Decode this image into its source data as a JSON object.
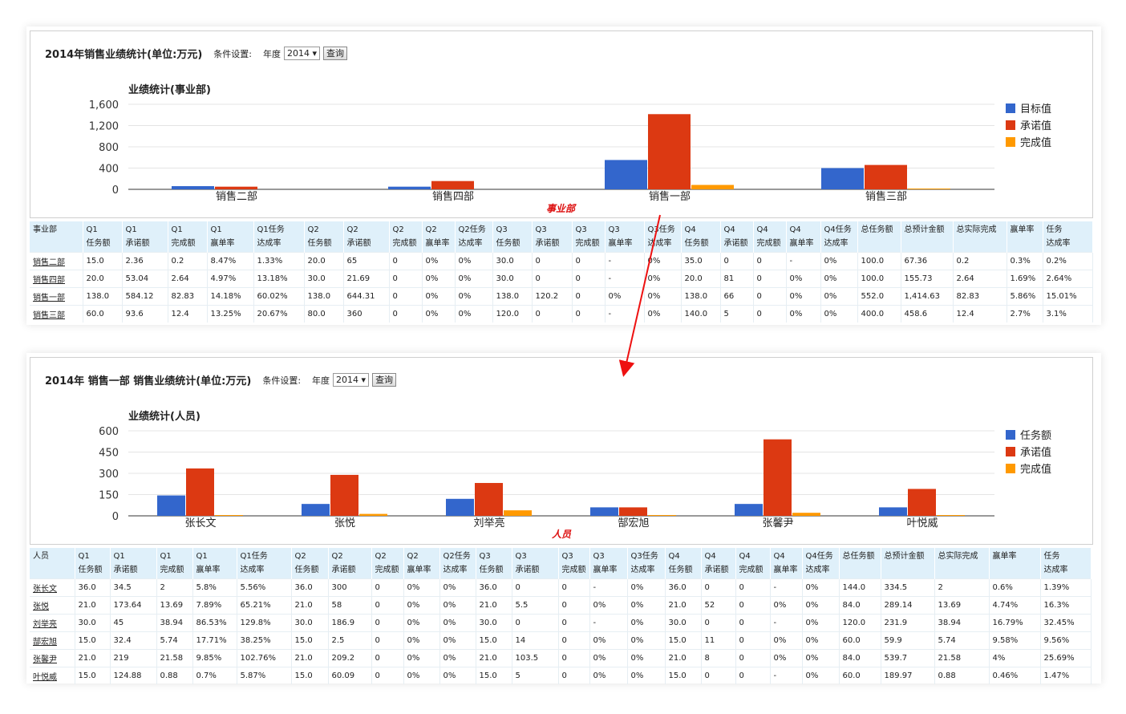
{
  "panel1": {
    "title": "2014年销售业绩统计(单位:万元)",
    "filter_label": "条件设置:",
    "year_label": "年度",
    "year_value": "2014 ▾",
    "query_label": "查询",
    "annotation": "事业部"
  },
  "panel2": {
    "title": "2014年 销售一部 销售业绩统计(单位:万元)",
    "filter_label": "条件设置:",
    "year_label": "年度",
    "year_value": "2014 ▾",
    "query_label": "查询",
    "annotation": "人员"
  },
  "colors": {
    "blue": "#3366cc",
    "red": "#dc3912",
    "orange": "#ff9900"
  },
  "chart_data": [
    {
      "type": "bar",
      "title": "业绩统计(事业部)",
      "categories": [
        "销售二部",
        "销售四部",
        "销售一部",
        "销售三部"
      ],
      "series": [
        {
          "name": "目标值",
          "values": [
            60,
            50,
            552,
            400
          ]
        },
        {
          "name": "承诺值",
          "values": [
            50,
            155.73,
            1414.63,
            458.6
          ]
        },
        {
          "name": "完成值",
          "values": [
            0,
            0,
            82.83,
            12.4
          ]
        }
      ],
      "yticks": [
        "0",
        "400",
        "800",
        "1,200",
        "1,600"
      ],
      "ylim": [
        0,
        1600
      ],
      "grid": true,
      "legend": "right"
    },
    {
      "type": "bar",
      "title": "业绩统计(人员)",
      "categories": [
        "张长文",
        "张悦",
        "刘举亮",
        "郜宏旭",
        "张馨尹",
        "叶悦威"
      ],
      "series": [
        {
          "name": "任务额",
          "values": [
            144,
            84,
            120,
            60,
            84,
            60
          ]
        },
        {
          "name": "承诺值",
          "values": [
            334.5,
            289.14,
            231.9,
            59.9,
            539.7,
            189.97
          ]
        },
        {
          "name": "完成值",
          "values": [
            2,
            13.69,
            38.94,
            5.74,
            21.58,
            0.88
          ]
        }
      ],
      "yticks": [
        "0",
        "150",
        "300",
        "450",
        "600"
      ],
      "ylim": [
        0,
        600
      ],
      "grid": true,
      "legend": "right"
    }
  ],
  "table1": {
    "headers": [
      [
        "事业部",
        ""
      ],
      [
        "Q1",
        "任务额"
      ],
      [
        "Q1",
        "承诺额"
      ],
      [
        "Q1",
        "完成额"
      ],
      [
        "Q1",
        "赢单率"
      ],
      [
        "Q1任务",
        "达成率"
      ],
      [
        "Q2",
        "任务额"
      ],
      [
        "Q2",
        "承诺额"
      ],
      [
        "Q2",
        "完成额"
      ],
      [
        "Q2",
        "赢单率"
      ],
      [
        "Q2任务",
        "达成率"
      ],
      [
        "Q3",
        "任务额"
      ],
      [
        "Q3",
        "承诺额"
      ],
      [
        "Q3",
        "完成额"
      ],
      [
        "Q3",
        "赢单率"
      ],
      [
        "Q3任务",
        "达成率"
      ],
      [
        "Q4",
        "任务额"
      ],
      [
        "Q4",
        "承诺额"
      ],
      [
        "Q4",
        "完成额"
      ],
      [
        "Q4",
        "赢单率"
      ],
      [
        "Q4任务",
        "达成率"
      ],
      [
        "总任务额",
        ""
      ],
      [
        "总预计金额",
        ""
      ],
      [
        "总实际完成",
        ""
      ],
      [
        "赢单率",
        ""
      ],
      [
        "任务",
        "达成率"
      ]
    ],
    "rows": [
      [
        "销售二部",
        "15.0",
        "2.36",
        "0.2",
        "8.47%",
        "1.33%",
        "20.0",
        "65",
        "0",
        "0%",
        "0%",
        "30.0",
        "0",
        "0",
        "-",
        "0%",
        "35.0",
        "0",
        "0",
        "-",
        "0%",
        "100.0",
        "67.36",
        "0.2",
        "0.3%",
        "0.2%"
      ],
      [
        "销售四部",
        "20.0",
        "53.04",
        "2.64",
        "4.97%",
        "13.18%",
        "30.0",
        "21.69",
        "0",
        "0%",
        "0%",
        "30.0",
        "0",
        "0",
        "-",
        "0%",
        "20.0",
        "81",
        "0",
        "0%",
        "0%",
        "100.0",
        "155.73",
        "2.64",
        "1.69%",
        "2.64%"
      ],
      [
        "销售一部",
        "138.0",
        "584.12",
        "82.83",
        "14.18%",
        "60.02%",
        "138.0",
        "644.31",
        "0",
        "0%",
        "0%",
        "138.0",
        "120.2",
        "0",
        "0%",
        "0%",
        "138.0",
        "66",
        "0",
        "0%",
        "0%",
        "552.0",
        "1,414.63",
        "82.83",
        "5.86%",
        "15.01%"
      ],
      [
        "销售三部",
        "60.0",
        "93.6",
        "12.4",
        "13.25%",
        "20.67%",
        "80.0",
        "360",
        "0",
        "0%",
        "0%",
        "120.0",
        "0",
        "0",
        "-",
        "0%",
        "140.0",
        "5",
        "0",
        "0%",
        "0%",
        "400.0",
        "458.6",
        "12.4",
        "2.7%",
        "3.1%"
      ]
    ]
  },
  "table2": {
    "headers": [
      [
        "人员",
        ""
      ],
      [
        "Q1",
        "任务额"
      ],
      [
        "Q1",
        "承诺额"
      ],
      [
        "Q1",
        "完成额"
      ],
      [
        "Q1",
        "赢单率"
      ],
      [
        "Q1任务",
        "达成率"
      ],
      [
        "Q2",
        "任务额"
      ],
      [
        "Q2",
        "承诺额"
      ],
      [
        "Q2",
        "完成额"
      ],
      [
        "Q2",
        "赢单率"
      ],
      [
        "Q2任务",
        "达成率"
      ],
      [
        "Q3",
        "任务额"
      ],
      [
        "Q3",
        "承诺额"
      ],
      [
        "Q3",
        "完成额"
      ],
      [
        "Q3",
        "赢单率"
      ],
      [
        "Q3任务",
        "达成率"
      ],
      [
        "Q4",
        "任务额"
      ],
      [
        "Q4",
        "承诺额"
      ],
      [
        "Q4",
        "完成额"
      ],
      [
        "Q4",
        "赢单率"
      ],
      [
        "Q4任务",
        "达成率"
      ],
      [
        "总任务额",
        ""
      ],
      [
        "总预计金额",
        ""
      ],
      [
        "总实际完成",
        ""
      ],
      [
        "赢单率",
        ""
      ],
      [
        "任务",
        "达成率"
      ]
    ],
    "rows": [
      [
        "张长文",
        "36.0",
        "34.5",
        "2",
        "5.8%",
        "5.56%",
        "36.0",
        "300",
        "0",
        "0%",
        "0%",
        "36.0",
        "0",
        "0",
        "-",
        "0%",
        "36.0",
        "0",
        "0",
        "-",
        "0%",
        "144.0",
        "334.5",
        "2",
        "0.6%",
        "1.39%"
      ],
      [
        "张悦",
        "21.0",
        "173.64",
        "13.69",
        "7.89%",
        "65.21%",
        "21.0",
        "58",
        "0",
        "0%",
        "0%",
        "21.0",
        "5.5",
        "0",
        "0%",
        "0%",
        "21.0",
        "52",
        "0",
        "0%",
        "0%",
        "84.0",
        "289.14",
        "13.69",
        "4.74%",
        "16.3%"
      ],
      [
        "刘举亮",
        "30.0",
        "45",
        "38.94",
        "86.53%",
        "129.8%",
        "30.0",
        "186.9",
        "0",
        "0%",
        "0%",
        "30.0",
        "0",
        "0",
        "-",
        "0%",
        "30.0",
        "0",
        "0",
        "-",
        "0%",
        "120.0",
        "231.9",
        "38.94",
        "16.79%",
        "32.45%"
      ],
      [
        "郜宏旭",
        "15.0",
        "32.4",
        "5.74",
        "17.71%",
        "38.25%",
        "15.0",
        "2.5",
        "0",
        "0%",
        "0%",
        "15.0",
        "14",
        "0",
        "0%",
        "0%",
        "15.0",
        "11",
        "0",
        "0%",
        "0%",
        "60.0",
        "59.9",
        "5.74",
        "9.58%",
        "9.56%"
      ],
      [
        "张馨尹",
        "21.0",
        "219",
        "21.58",
        "9.85%",
        "102.76%",
        "21.0",
        "209.2",
        "0",
        "0%",
        "0%",
        "21.0",
        "103.5",
        "0",
        "0%",
        "0%",
        "21.0",
        "8",
        "0",
        "0%",
        "0%",
        "84.0",
        "539.7",
        "21.58",
        "4%",
        "25.69%"
      ],
      [
        "叶悦威",
        "15.0",
        "124.88",
        "0.88",
        "0.7%",
        "5.87%",
        "15.0",
        "60.09",
        "0",
        "0%",
        "0%",
        "15.0",
        "5",
        "0",
        "0%",
        "0%",
        "15.0",
        "0",
        "0",
        "-",
        "0%",
        "60.0",
        "189.97",
        "0.88",
        "0.46%",
        "1.47%"
      ]
    ]
  }
}
